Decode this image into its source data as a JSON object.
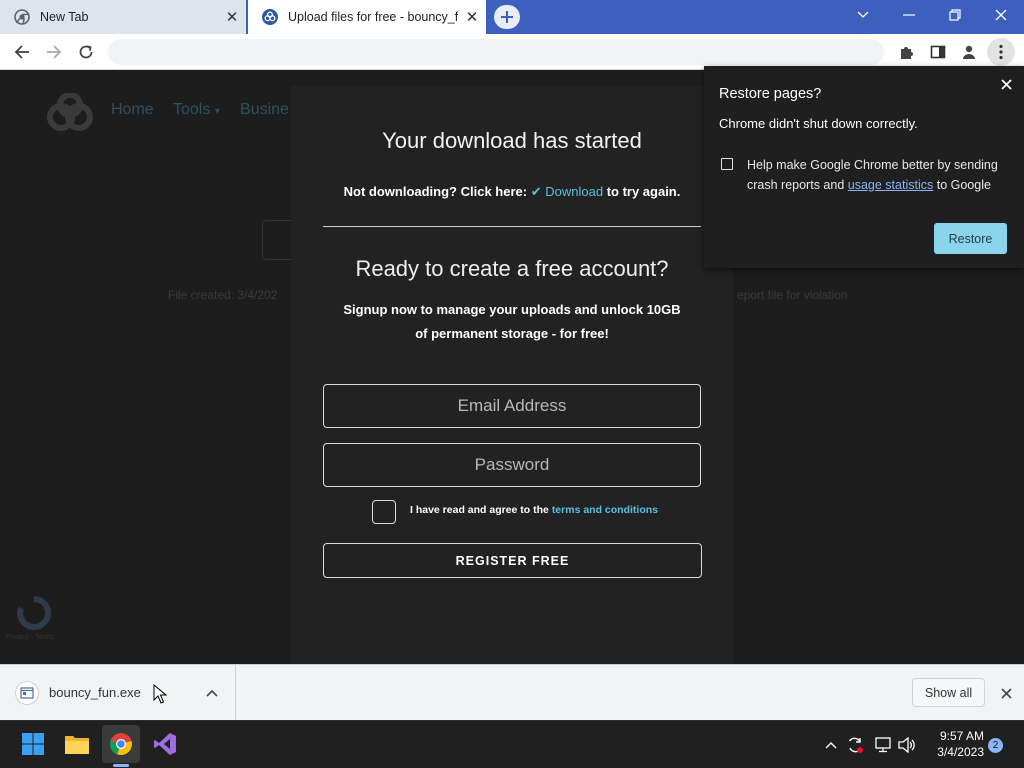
{
  "browser": {
    "tabs": [
      {
        "title": "New Tab",
        "active": false
      },
      {
        "title": "Upload files for free - bouncy_fun",
        "active": true
      }
    ],
    "omnibox": {
      "value": ""
    }
  },
  "page": {
    "nav": [
      "Home",
      "Tools",
      "Busine"
    ],
    "file_created": "File created: 3/4/202",
    "report_link": "eport file for violation",
    "recaptcha": "Privacy - Terms",
    "modal": {
      "title": "Your download has started",
      "not_downloading": "Not downloading? Click here:",
      "download_link": "Download",
      "try_again": "to try again.",
      "account_title": "Ready to create a free account?",
      "pitch": "Signup now to manage your uploads and unlock 10GB of permanent storage - for free!",
      "email_placeholder": "Email Address",
      "password_placeholder": "Password",
      "agree_text": "I have read and agree to the",
      "terms_link": "terms and conditions",
      "register_label": "REGISTER FREE"
    }
  },
  "restore_bubble": {
    "title": "Restore pages?",
    "message": "Chrome didn't shut down correctly.",
    "checkbox_before": "Help make Google Chrome better by sending crash reports and",
    "checkbox_link": "usage statistics",
    "checkbox_after": "to Google",
    "checked": false,
    "button": "Restore"
  },
  "download_shelf": {
    "file_name": "bouncy_fun.exe",
    "show_all": "Show all"
  },
  "taskbar": {
    "time": "9:57 AM",
    "date": "3/4/2023",
    "notification_count": "2"
  },
  "colors": {
    "tabstrip": "#3d5fbe",
    "link": "#5bc0de",
    "restore_button": "#8ad5ec"
  }
}
